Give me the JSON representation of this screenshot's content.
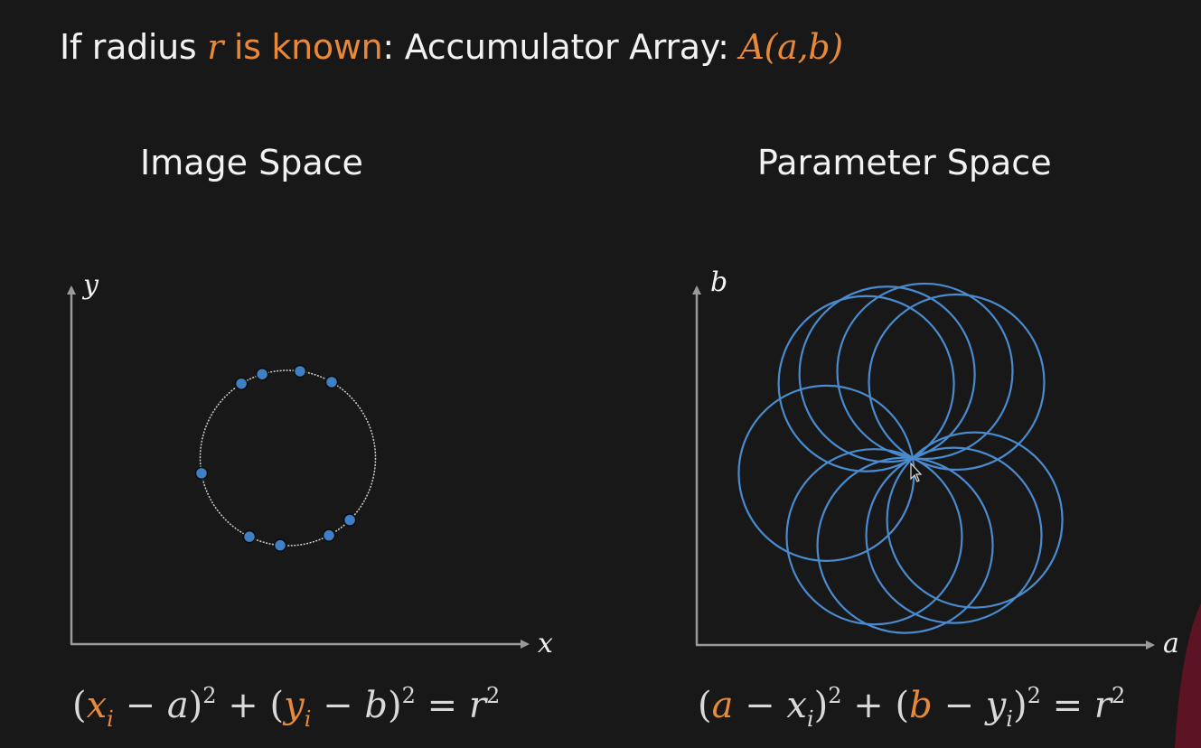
{
  "title": {
    "prefix": "If radius ",
    "var_r": "r",
    "known": " is known",
    "colon_text": ": Accumulator Array: ",
    "accumulator": "A(a,b)"
  },
  "image_space": {
    "heading": "Image Space",
    "x_axis_label": "x",
    "y_axis_label": "y",
    "equation": {
      "open1": "(",
      "xi": "x",
      "xi_sub": "i",
      "minus1": " − ",
      "a": "a",
      "close1": ")",
      "sq1": "2",
      "plus": " + ",
      "open2": "(",
      "yi": "y",
      "yi_sub": "i",
      "minus2": " − ",
      "b": "b",
      "close2": ")",
      "sq2": "2",
      "eq": " = ",
      "r": "r",
      "sq3": "2"
    }
  },
  "parameter_space": {
    "heading": "Parameter Space",
    "x_axis_label": "a",
    "y_axis_label": "b",
    "equation": {
      "open1": "(",
      "a": "a",
      "minus1": " − ",
      "xi": "x",
      "xi_sub": "i",
      "close1": ")",
      "sq1": "2",
      "plus": " + ",
      "open2": "(",
      "b": "b",
      "minus2": " − ",
      "yi": "y",
      "yi_sub": "i",
      "close2": ")",
      "sq2": "2",
      "eq": " = ",
      "r": "r",
      "sq3": "2"
    }
  },
  "colors": {
    "background": "#181818",
    "text": "#f2f2f2",
    "accent": "#e8893a",
    "point_fill": "#3f7fc6",
    "circle_stroke": "#4a8bd0",
    "axis": "#9a9a9a",
    "dashed_circle": "#cfcfcf"
  },
  "edge_points_angles_deg": [
    238,
    253,
    278,
    300,
    170,
    116,
    95,
    62,
    45
  ]
}
